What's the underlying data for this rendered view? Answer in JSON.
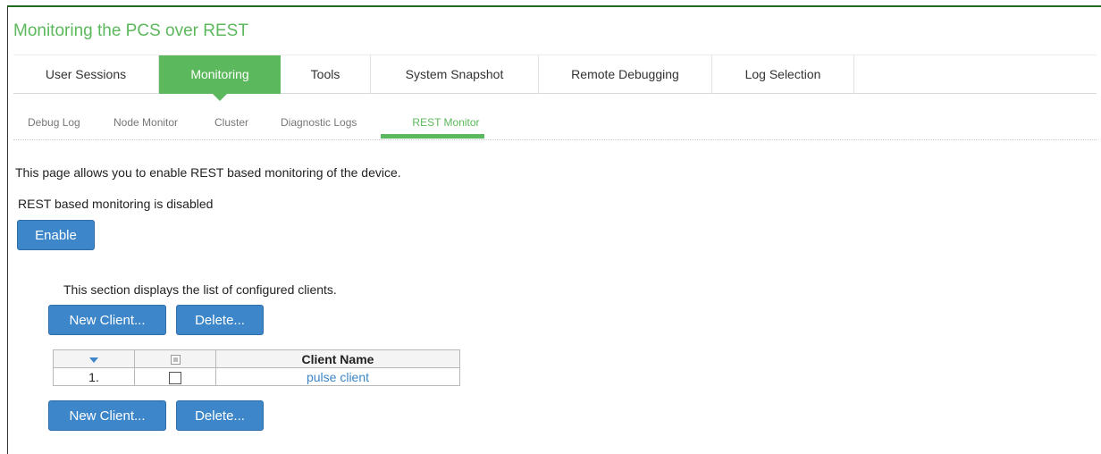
{
  "header": {
    "title": "Monitoring the PCS over REST"
  },
  "main_tabs": [
    {
      "label": "User Sessions",
      "active": false
    },
    {
      "label": "Monitoring",
      "active": true
    },
    {
      "label": "Tools",
      "active": false
    },
    {
      "label": "System Snapshot",
      "active": false
    },
    {
      "label": "Remote Debugging",
      "active": false
    },
    {
      "label": "Log Selection",
      "active": false
    }
  ],
  "sub_tabs": [
    {
      "label": "Debug Log",
      "active": false
    },
    {
      "label": "Node Monitor",
      "active": false
    },
    {
      "label": "Cluster",
      "active": false
    },
    {
      "label": "Diagnostic Logs",
      "active": false
    },
    {
      "label": "REST Monitor",
      "active": true
    }
  ],
  "content": {
    "intro": "This page allows you to enable REST based monitoring of the device.",
    "status": "REST based monitoring is disabled",
    "enable_label": "Enable",
    "clients_intro": "This section displays the list of configured clients.",
    "new_client_label": "New Client...",
    "delete_label": "Delete..."
  },
  "table": {
    "headers": {
      "sort_icon": "sort-down-icon",
      "select_icon": "select-all-checkbox-icon",
      "name": "Client Name"
    },
    "rows": [
      {
        "index": "1.",
        "checked": false,
        "name": "pulse client"
      }
    ]
  },
  "colors": {
    "accent_green": "#5cb85c",
    "button_blue": "#3c86c9",
    "link_blue": "#3c86c9"
  }
}
